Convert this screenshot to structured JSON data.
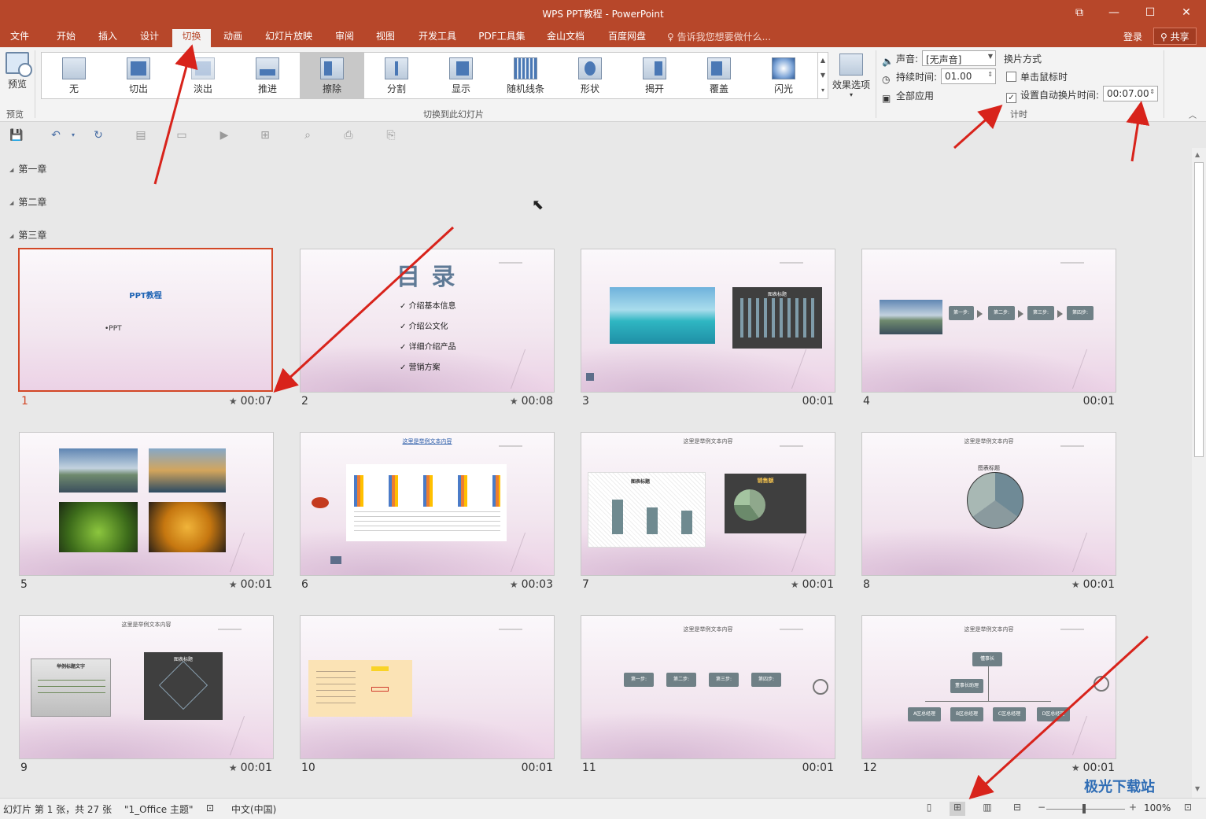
{
  "window": {
    "title": "WPS PPT教程 - PowerPoint"
  },
  "menu": {
    "tabs": [
      "文件",
      "开始",
      "插入",
      "设计",
      "切换",
      "动画",
      "幻灯片放映",
      "审阅",
      "视图",
      "开发工具",
      "PDF工具集",
      "金山文档",
      "百度网盘"
    ],
    "active": "切换",
    "search": "告诉我您想要做什么...",
    "login": "登录",
    "share": "共享"
  },
  "ribbon": {
    "preview_label": "预览",
    "preview_group": "预览",
    "transitions": [
      "无",
      "切出",
      "淡出",
      "推进",
      "擦除",
      "分割",
      "显示",
      "随机线条",
      "形状",
      "揭开",
      "覆盖",
      "闪光"
    ],
    "selected_transition": "擦除",
    "gallery_group": "切换到此幻灯片",
    "effect_options": "效果选项",
    "sound_label": "声音:",
    "sound_value": "[无声音]",
    "duration_label": "持续时间:",
    "duration_value": "01.00",
    "apply_all": "全部应用",
    "advance_title": "换片方式",
    "on_click": "单击鼠标时",
    "on_click_checked": false,
    "auto_after": "设置自动换片时间:",
    "auto_after_checked": true,
    "auto_value": "00:07.00",
    "timing_group": "计时"
  },
  "sections": [
    "第一章",
    "第二章",
    "第三章"
  ],
  "slides": [
    {
      "num": "1",
      "time": "00:07",
      "star": true,
      "title": "PPT教程",
      "sub": "•PPT"
    },
    {
      "num": "2",
      "time": "00:08",
      "star": true,
      "title": "目 录",
      "items": [
        "介绍基本信息",
        "介绍公文化",
        "详细介绍产品",
        "营销方案"
      ]
    },
    {
      "num": "3",
      "time": "00:01",
      "star": false,
      "chart_title": "图表标题"
    },
    {
      "num": "4",
      "time": "00:01",
      "star": false,
      "steps": [
        "第一步:",
        "第二步:",
        "第三步:",
        "第四步:"
      ]
    },
    {
      "num": "5",
      "time": "00:01",
      "star": true
    },
    {
      "num": "6",
      "time": "00:03",
      "star": true,
      "heading": "这里是举例文本内容"
    },
    {
      "num": "7",
      "time": "00:01",
      "star": true,
      "heading": "这里是举例文本内容",
      "chart1": "图表标题",
      "chart2": "销售额"
    },
    {
      "num": "8",
      "time": "00:01",
      "star": true,
      "heading": "这里是举例文本内容",
      "chart1": "图表标题"
    },
    {
      "num": "9",
      "time": "00:01",
      "star": true,
      "heading": "这里是举例文本内容",
      "box1": "举例标题文字",
      "box2": "图表标题"
    },
    {
      "num": "10",
      "time": "00:01",
      "star": false
    },
    {
      "num": "11",
      "time": "00:01",
      "star": false,
      "heading": "这里是举例文本内容",
      "steps": [
        "第一步:",
        "第二步:",
        "第三步:",
        "第四步:"
      ]
    },
    {
      "num": "12",
      "time": "00:01",
      "star": true,
      "heading": "这里是举例文本内容",
      "org": [
        "懂事长",
        "董事长助理",
        "A区总经理",
        "B区总经理",
        "C区总经理",
        "D区总经理"
      ]
    }
  ],
  "status": {
    "slide_info": "幻灯片 第 1 张，共 27 张",
    "theme": "\"1_Office 主题\"",
    "language": "中文(中国)",
    "zoom": "100%"
  },
  "watermark": {
    "text": "极光下载站"
  }
}
